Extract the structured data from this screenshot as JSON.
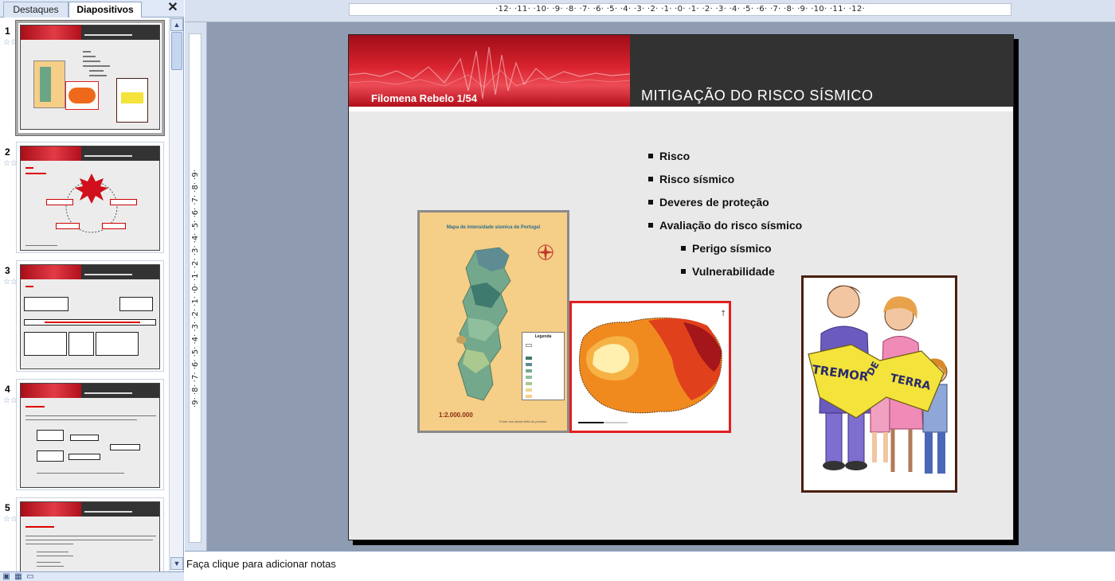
{
  "pane": {
    "tabs": [
      {
        "label": "Destaques"
      },
      {
        "label": "Diapositivos"
      }
    ],
    "close_glyph": "✕"
  },
  "thumbnails": [
    {
      "number": "1",
      "star_glyph": "☆☆"
    },
    {
      "number": "2",
      "star_glyph": "☆☆"
    },
    {
      "number": "3",
      "star_glyph": "☆☆"
    },
    {
      "number": "4",
      "star_glyph": "☆☆"
    },
    {
      "number": "5",
      "star_glyph": "☆☆"
    }
  ],
  "ruler": {
    "horizontal": "·12· ·11· ·10· ·9· ·8· ·7· ·6· ·5· ·4· ·3· ·2· ·1· ·0· ·1· ·2· ·3· ·4· ·5· ·6· ·7· ·8· ·9· ·10· ·11· ·12·",
    "vertical": "·9· ·8· ·7· ·6· ·5· ·4· ·3· ·2· ·1· ·0· ·1· ·2· ·3· ·4· ·5· ·6· ·7· ·8· ·9·"
  },
  "slide": {
    "author": "Filomena Rebelo 1/54",
    "title": "MITIGAÇÃO DO RISCO SÍSMICO",
    "bullets": [
      {
        "text": "Risco",
        "level": 1
      },
      {
        "text": "Risco sísmico",
        "level": 1
      },
      {
        "text": "Deveres de proteção",
        "level": 1
      },
      {
        "text": "Avaliação do risco sísmico",
        "level": 1
      },
      {
        "text": "Perigo sísmico",
        "level": 2
      },
      {
        "text": "Vulnerabilidade",
        "level": 2
      }
    ],
    "map": {
      "title": "Mapa de intensidade sísmica de Portugal",
      "scale": "1:2.000.000",
      "legend_title": "Legenda",
      "source": "Fonte dos dados feita do próximo"
    },
    "illustration": {
      "sign_words": [
        "TREMOR",
        "DE",
        "TERRA"
      ]
    }
  },
  "notes": {
    "placeholder": "Faça clique para adicionar notas"
  },
  "colors": {
    "header_red": "#d9232f",
    "header_dark": "#323232",
    "slide_bg": "#e9e9e9",
    "workspace_bg": "#8e9bb0",
    "ruler_bg": "#d8e1ef"
  }
}
